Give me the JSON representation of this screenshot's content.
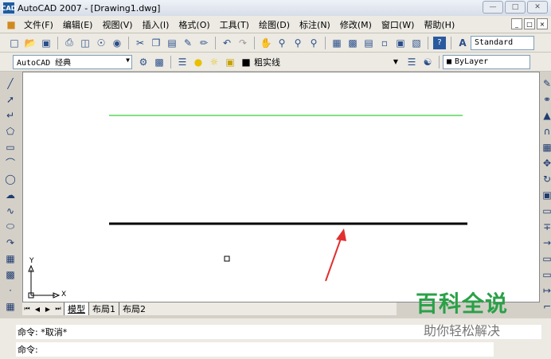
{
  "window": {
    "title": "AutoCAD 2007 - [Drawing1.dwg]",
    "icon": "CAD"
  },
  "menu": [
    "文件(F)",
    "编辑(E)",
    "视图(V)",
    "插入(I)",
    "格式(O)",
    "工具(T)",
    "绘图(D)",
    "标注(N)",
    "修改(M)",
    "窗口(W)",
    "帮助(H)"
  ],
  "toolbar": {
    "textstyle": "Standard"
  },
  "toolbar2": {
    "workspace": "AutoCAD 经典",
    "layer": "粗实线",
    "color": "ByLayer"
  },
  "canvas": {
    "y_axis_label": "Y",
    "x_axis_label": "X"
  },
  "layout_tabs": [
    "模型",
    "布局1",
    "布局2"
  ],
  "command": {
    "line1": "命令: *取消*",
    "line2": "命令:"
  },
  "watermark": {
    "title": "百科全说",
    "subtitle": "助你轻松解决"
  },
  "colors": {
    "thin_line": "#00c000",
    "thick_line": "#000000",
    "arrow": "#e03030",
    "watermark_green": "#2aa147"
  }
}
